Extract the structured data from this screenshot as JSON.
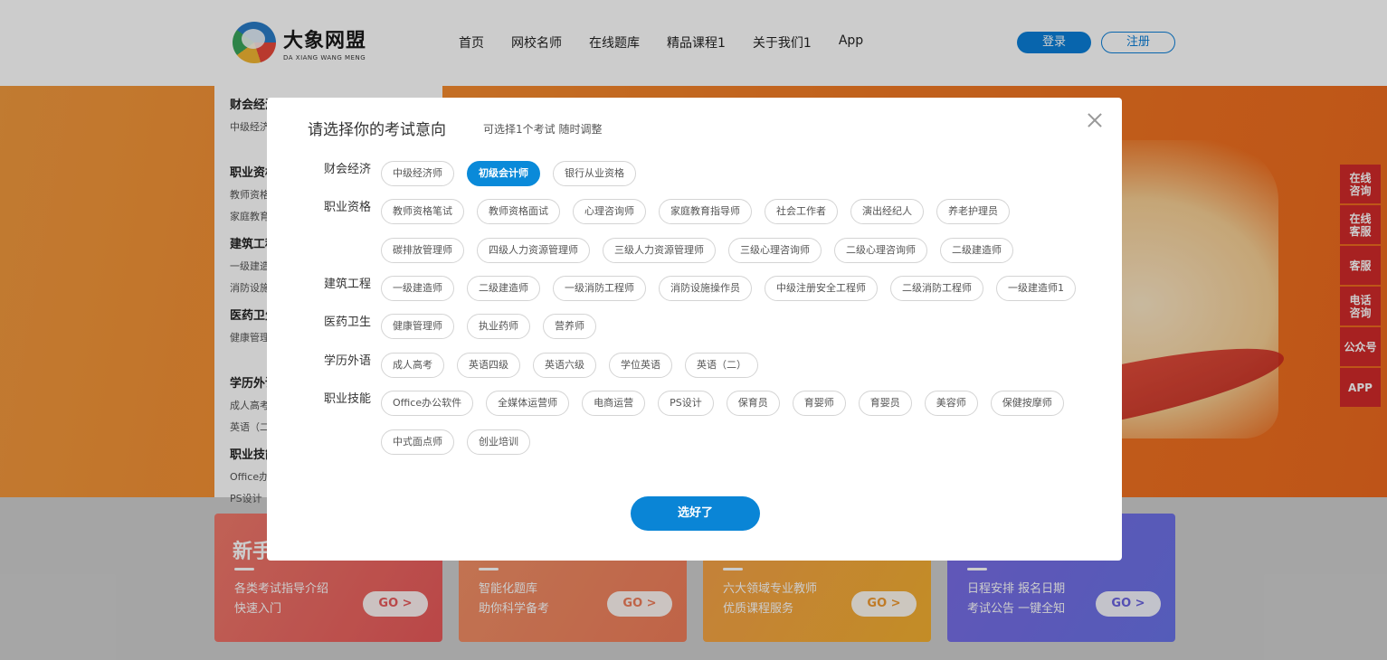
{
  "header": {
    "logo_cn": "大象网盟",
    "logo_en": "DA XIANG WANG MENG",
    "nav": [
      "首页",
      "网校名师",
      "在线题库",
      "精品课程1",
      "关于我们1",
      "App"
    ],
    "login": "登录",
    "register": "注册"
  },
  "side_menu": [
    {
      "title": "财会经济",
      "subs": [
        "中级经济师"
      ]
    },
    {
      "title": "职业资格",
      "subs": [
        "教师资格",
        "家庭教育"
      ]
    },
    {
      "title": "建筑工程",
      "subs": [
        "一级建造",
        "消防设施"
      ]
    },
    {
      "title": "医药卫生",
      "subs": [
        "健康管理"
      ]
    },
    {
      "title": "学历外语",
      "subs": [
        "成人高考",
        "英语（二"
      ]
    },
    {
      "title": "职业技能",
      "subs": [
        "Office办",
        "PS设计"
      ]
    }
  ],
  "cards": [
    {
      "title": "新手",
      "desc": "各类考试指导介绍\n快速入门",
      "go": "GO >",
      "gradient": "linear-gradient(120deg,#f07a6c,#e8595a)",
      "go_color": "#e8595a"
    },
    {
      "title": "",
      "desc": "智能化题库\n助你科学备考",
      "go": "GO >",
      "gradient": "linear-gradient(120deg,#f39268,#ef7d5a)",
      "go_color": "#ef7d5a"
    },
    {
      "title": "",
      "desc": "六大领域专业教师\n优质课程服务",
      "go": "GO >",
      "gradient": "linear-gradient(120deg,#f5a14a,#f4b030)",
      "go_color": "#f09a30"
    },
    {
      "title": "",
      "desc": "日程安排  报名日期\n考试公告  一键全知",
      "go": "GO >",
      "gradient": "linear-gradient(120deg,#7a6ce6,#6a73e8)",
      "go_color": "#6a63e0"
    }
  ],
  "float_bar": [
    "在线\n咨询",
    "在线\n客服",
    "客服",
    "电话\n咨询",
    "公众号",
    "APP"
  ],
  "modal": {
    "title": "请选择你的考试意向",
    "subtitle": "可选择1个考试 随时调整",
    "confirm": "选好了",
    "selected": "初级会计师",
    "categories": [
      {
        "label": "财会经济",
        "tags": [
          "中级经济师",
          "初级会计师",
          "银行从业资格"
        ]
      },
      {
        "label": "职业资格",
        "tags": [
          "教师资格笔试",
          "教师资格面试",
          "心理咨询师",
          "家庭教育指导师",
          "社会工作者",
          "演出经纪人",
          "养老护理员",
          "碳排放管理师",
          "四级人力资源管理师",
          "三级人力资源管理师",
          "三级心理咨询师",
          "二级心理咨询师",
          "二级建造师"
        ]
      },
      {
        "label": "建筑工程",
        "tags": [
          "一级建造师",
          "二级建造师",
          "一级消防工程师",
          "消防设施操作员",
          "中级注册安全工程师",
          "二级消防工程师",
          "一级建造师1"
        ]
      },
      {
        "label": "医药卫生",
        "tags": [
          "健康管理师",
          "执业药师",
          "营养师"
        ]
      },
      {
        "label": "学历外语",
        "tags": [
          "成人高考",
          "英语四级",
          "英语六级",
          "学位英语",
          "英语（二）"
        ]
      },
      {
        "label": "职业技能",
        "tags": [
          "Office办公软件",
          "全媒体运营师",
          "电商运营",
          "PS设计",
          "保育员",
          "育婴师",
          "育婴员",
          "美容师",
          "保健按摩师",
          "中式面点师",
          "创业培训"
        ]
      }
    ]
  }
}
